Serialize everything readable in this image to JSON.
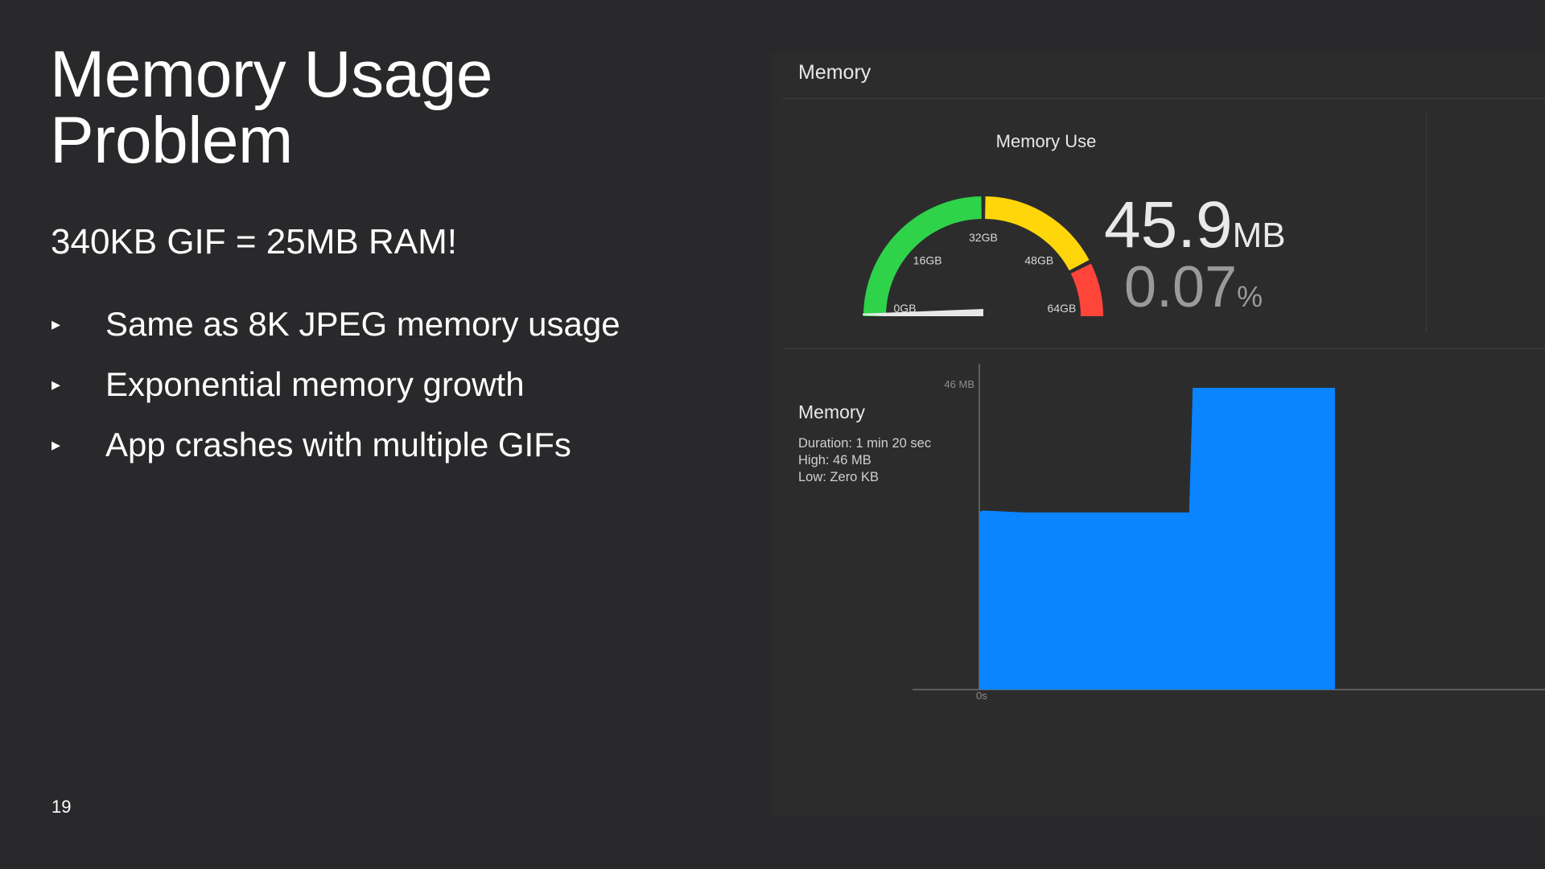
{
  "slide": {
    "title_line1": "Memory Usage",
    "title_line2": "Problem",
    "subtitle": "340KB GIF = 25MB RAM!",
    "bullets": [
      {
        "marker": "▸",
        "text": "Same as 8K JPEG memory usage"
      },
      {
        "marker": "▸",
        "text": "Exponential memory growth"
      },
      {
        "marker": "▸",
        "text": "App crashes with multiple GIFs"
      }
    ],
    "page_number": "19"
  },
  "panel": {
    "title": "Memory",
    "gauge": {
      "heading": "Memory Use",
      "tick_labels": [
        "0GB",
        "16GB",
        "32GB",
        "48GB",
        "64GB"
      ],
      "colors": {
        "green": "#2fd34a",
        "yellow": "#ffd60a",
        "red": "#ff453a"
      },
      "needle_fraction": 0.0007,
      "value": "45.9",
      "value_unit": "MB",
      "percent": "0.07",
      "percent_unit": "%"
    },
    "graph": {
      "title": "Memory",
      "duration": "Duration: 1 min 20 sec",
      "high": "High: 46 MB",
      "low": "Low: Zero KB",
      "y_max_label": "46 MB",
      "x_start_label": "0s",
      "fill_color": "#0a84ff"
    }
  },
  "chart_data": {
    "type": "area",
    "x": [
      0,
      0.01,
      0.13,
      0.59,
      0.6,
      1.0
    ],
    "values": [
      27.1,
      27.3,
      27.0,
      27.0,
      46.0,
      46.0
    ],
    "ylabel": "46 MB",
    "xlabel": "0s",
    "ylim": [
      0,
      46
    ],
    "grid": false,
    "color": "#0a84ff"
  }
}
